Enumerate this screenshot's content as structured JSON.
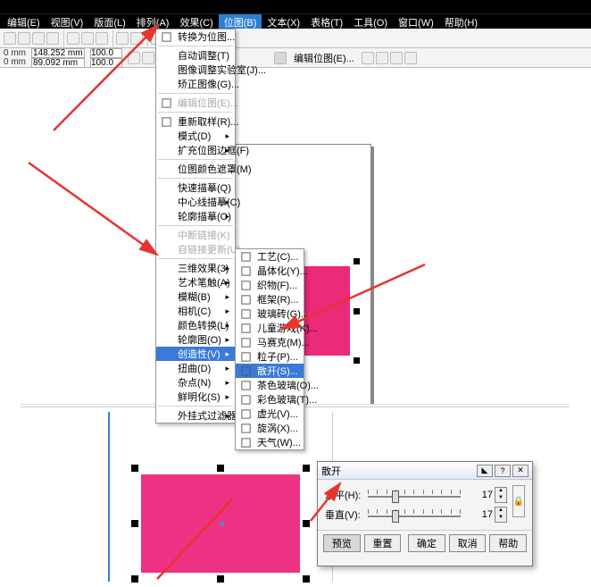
{
  "menubar": [
    "编辑(E)",
    "视图(V)",
    "版面(L)",
    "排列(A)",
    "效果(C)",
    "位图(B)",
    "文本(X)",
    "表格(T)",
    "工具(O)",
    "窗口(W)",
    "帮助(H)"
  ],
  "hlMenuIndex": 5,
  "prop": {
    "x": "148.252 mm",
    "y": "89.092 mm",
    "w": "100.0",
    "h": "100.0",
    "right_label": "编辑位图(E)..."
  },
  "menu1": [
    {
      "label": "转换为位图...",
      "ic": "convert"
    },
    {
      "sep": true
    },
    {
      "label": "自动调整(T)"
    },
    {
      "label": "图像调整实验室(J)..."
    },
    {
      "label": "矫正图像(G)..."
    },
    {
      "sep": true
    },
    {
      "label": "编辑位图(E)...",
      "ic": "edit",
      "dis": true
    },
    {
      "sep": true
    },
    {
      "label": "重新取样(R)...",
      "ic": "resample"
    },
    {
      "label": "模式(D)",
      "sub": true
    },
    {
      "label": "扩充位图边框(F)",
      "sub": true
    },
    {
      "sep": true
    },
    {
      "label": "位图颜色遮罩(M)"
    },
    {
      "sep": true
    },
    {
      "label": "快速描摹(Q)"
    },
    {
      "label": "中心线描摹(C)",
      "sub": true
    },
    {
      "label": "轮廓描摹(O)",
      "sub": true
    },
    {
      "sep": true
    },
    {
      "label": "中断链接(K)",
      "dis": true
    },
    {
      "label": "自链接更新(U)",
      "dis": true
    },
    {
      "sep": true
    },
    {
      "label": "三维效果(3)",
      "sub": true
    },
    {
      "label": "艺术笔触(A)",
      "sub": true
    },
    {
      "label": "模糊(B)",
      "sub": true
    },
    {
      "label": "相机(C)",
      "sub": true
    },
    {
      "label": "颜色转换(L)",
      "sub": true
    },
    {
      "label": "轮廓图(O)",
      "sub": true
    },
    {
      "label": "创造性(V)",
      "sub": true,
      "hl": true
    },
    {
      "label": "扭曲(D)",
      "sub": true
    },
    {
      "label": "杂点(N)",
      "sub": true
    },
    {
      "label": "鲜明化(S)",
      "sub": true
    },
    {
      "sep": true
    },
    {
      "label": "外挂式过滤器(P)",
      "sub": true
    }
  ],
  "menu2": [
    {
      "label": "工艺(C)...",
      "ic": "sq"
    },
    {
      "label": "晶体化(Y)...",
      "ic": "sq"
    },
    {
      "label": "织物(F)...",
      "ic": "sq"
    },
    {
      "label": "框架(R)...",
      "ic": "sq"
    },
    {
      "label": "玻璃砖(G)...",
      "ic": "sq"
    },
    {
      "label": "儿童游戏(K)...",
      "ic": "sq"
    },
    {
      "label": "马赛克(M)...",
      "ic": "sq"
    },
    {
      "label": "粒子(P)...",
      "ic": "sq"
    },
    {
      "label": "散开(S)...",
      "hl": true,
      "ic": "sq"
    },
    {
      "label": "茶色玻璃(O)...",
      "ic": "sq"
    },
    {
      "label": "彩色玻璃(T)...",
      "ic": "sq"
    },
    {
      "label": "虚光(V)...",
      "ic": "sq"
    },
    {
      "label": "旋涡(X)...",
      "ic": "sq"
    },
    {
      "label": "天气(W)...",
      "ic": "sq"
    }
  ],
  "dialog": {
    "title": "散开",
    "horiz_label": "水平(H):",
    "vert_label": "垂直(V):",
    "value": "17",
    "buttons": {
      "preview": "预览",
      "reset": "重置",
      "ok": "确定",
      "cancel": "取消",
      "help": "帮助"
    }
  }
}
